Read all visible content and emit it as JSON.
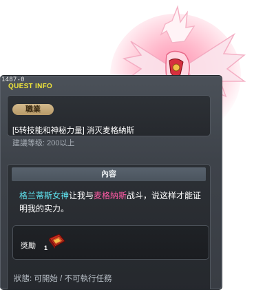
{
  "quest": {
    "id": "1487-0",
    "panel_title": "QUEST INFO",
    "category": "職業",
    "name": "[5转技能和神秘力量] 消灭麦格納斯",
    "recommended_level": "建議等级: 200以上"
  },
  "content": {
    "header": "內容",
    "description_part1": "格兰蒂斯女神",
    "description_part2": "让我与",
    "description_part3": "麦格納斯",
    "description_part4": "战斗，说这样才能证明我的实力。"
  },
  "reward": {
    "label": "獎勵",
    "item_icon": "red-scroll-icon",
    "quantity": "1"
  },
  "status": "狀態: 可開始 / 不可執行任務",
  "colors": {
    "title_yellow": "#f0e53a",
    "goddess_cyan": "#5fe6f2",
    "target_pink": "#ff5aa5",
    "badge_tan": "#c8ab7a"
  }
}
